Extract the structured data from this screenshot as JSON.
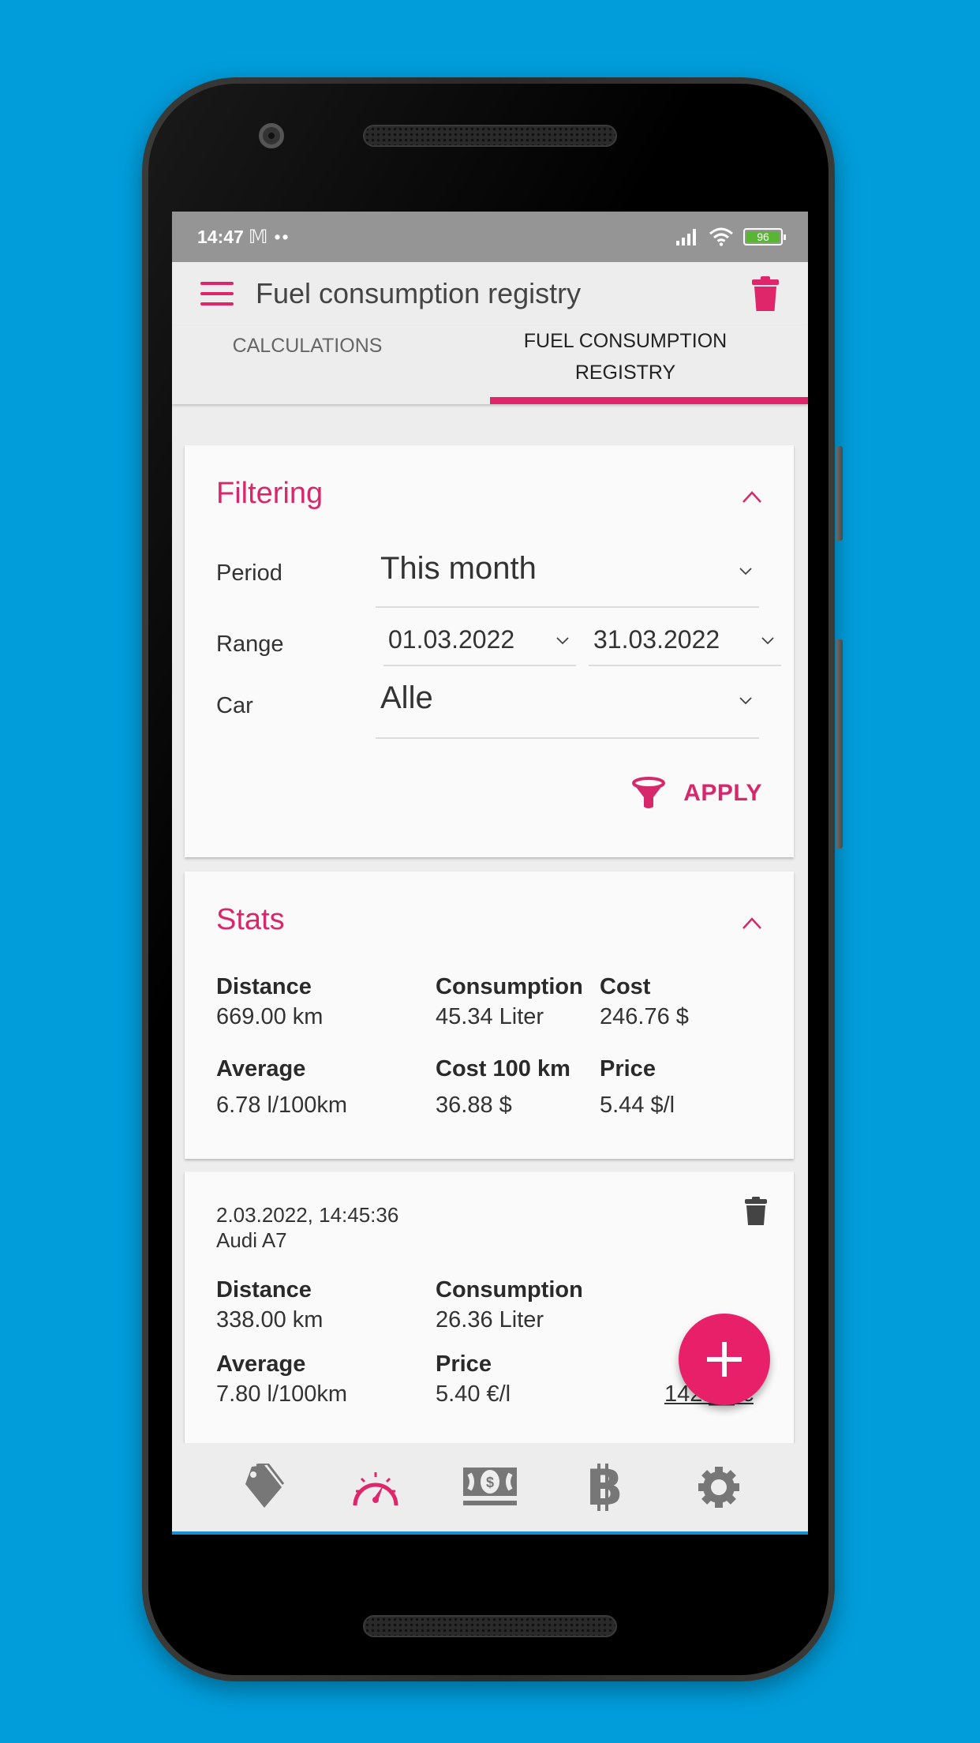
{
  "status_bar": {
    "time": "14:47",
    "notification_icons": [
      "gmail-icon",
      "more-dots"
    ],
    "battery_level": "96"
  },
  "app_bar": {
    "title": "Fuel consumption registry",
    "menu_icon": "hamburger-menu-icon",
    "action_icon": "trash-icon"
  },
  "tabs": [
    {
      "label": "CALCULATIONS",
      "active": false
    },
    {
      "label": "FUEL CONSUMPTION REGISTRY",
      "active": true
    }
  ],
  "filtering": {
    "title": "Filtering",
    "period_label": "Period",
    "period_value": "This month",
    "range_label": "Range",
    "range_from": "01.03.2022",
    "range_to": "31.03.2022",
    "car_label": "Car",
    "car_value": "Alle",
    "apply_label": "APPLY"
  },
  "stats": {
    "title": "Stats",
    "items": [
      {
        "label": "Distance",
        "value": "669.00 km"
      },
      {
        "label": "Consumption",
        "value": "45.34 Liter"
      },
      {
        "label": "Cost",
        "value": "246.76 $"
      },
      {
        "label": "Average",
        "value": "6.78 l/100km"
      },
      {
        "label": "Cost 100 km",
        "value": "36.88 $"
      },
      {
        "label": "Price",
        "value": "5.44 $/l"
      }
    ]
  },
  "entry": {
    "datetime": "2.03.2022, 14:45:36",
    "car": "Audi A7",
    "items": [
      {
        "label": "Distance",
        "value": "338.00 km"
      },
      {
        "label": "Consumption",
        "value": "26.36 Liter"
      },
      {
        "label": "Average",
        "value": "7.80 l/100km"
      },
      {
        "label": "Price",
        "value": "5.40 €/l"
      }
    ],
    "total_partial": "142.__ €"
  },
  "fab": {
    "icon": "plus-icon"
  },
  "bottom_nav": [
    {
      "icon": "tag-icon",
      "active": false
    },
    {
      "icon": "speedometer-icon",
      "active": true
    },
    {
      "icon": "money-icon",
      "active": false
    },
    {
      "icon": "bitcoin-icon",
      "active": false
    },
    {
      "icon": "settings-gear-icon",
      "active": false
    }
  ],
  "colors": {
    "accent": "#e0266b",
    "background": "#009ddb",
    "statusbar": "#959595"
  }
}
